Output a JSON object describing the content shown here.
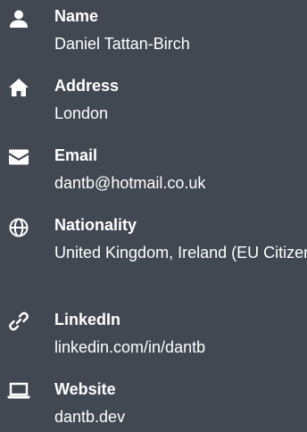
{
  "contact": {
    "name": {
      "label": "Name",
      "value": "Daniel Tattan-Birch",
      "icon": "person-icon"
    },
    "address": {
      "label": "Address",
      "value": "London",
      "icon": "home-icon"
    },
    "email": {
      "label": "Email",
      "value": "dantb@hotmail.co.uk",
      "icon": "envelope-icon"
    },
    "nationality": {
      "label": "Nationality",
      "value": "United Kingdom, Ireland (EU Citizen)",
      "icon": "globe-icon"
    },
    "linkedin": {
      "label": "LinkedIn",
      "value": "linkedin.com/in/dantb",
      "icon": "link-icon"
    },
    "website": {
      "label": "Website",
      "value": "dantb.dev",
      "icon": "laptop-icon"
    }
  },
  "colors": {
    "background": "#424852",
    "text": "#ffffff"
  }
}
